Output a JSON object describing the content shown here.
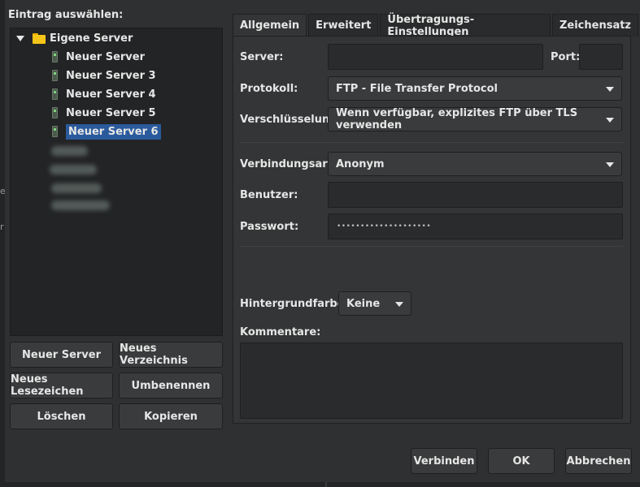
{
  "backdrop": {
    "frag1": "e",
    "frag2": "r"
  },
  "left": {
    "title": "Eintrag auswählen:",
    "tree": {
      "root": "Eigene Server",
      "items": [
        "Neuer Server",
        "Neuer Server 3",
        "Neuer Server 4",
        "Neuer Server 5",
        "Neuer Server 6"
      ],
      "selected": "Neuer Server 6"
    },
    "buttons": {
      "new_server": "Neuer Server",
      "new_folder": "Neues Verzeichnis",
      "new_bookmark": "Neues Lesezeichen",
      "rename": "Umbenennen",
      "delete": "Löschen",
      "copy": "Kopieren"
    }
  },
  "tabs": [
    "Allgemein",
    "Erweitert",
    "Übertragungs-Einstellungen",
    "Zeichensatz"
  ],
  "active_tab": "Allgemein",
  "general": {
    "server_label": "Server:",
    "server_value": "",
    "port_label": "Port:",
    "port_value": "",
    "protocol_label": "Protokoll:",
    "protocol_value": "FTP - File Transfer Protocol",
    "encryption_label": "Verschlüsselung:",
    "encryption_value": "Wenn verfügbar, explizites FTP über TLS verwenden",
    "logon_label": "Verbindungsart:",
    "logon_value": "Anonym",
    "user_label": "Benutzer:",
    "user_value": "",
    "password_label": "Passwort:",
    "password_value": "••••••••••••••••••••",
    "bgcolor_label": "Hintergrundfarbe:",
    "bgcolor_value": "Keine",
    "comments_label": "Kommentare:"
  },
  "footer": {
    "connect": "Verbinden",
    "ok": "OK",
    "cancel": "Abbrechen"
  }
}
